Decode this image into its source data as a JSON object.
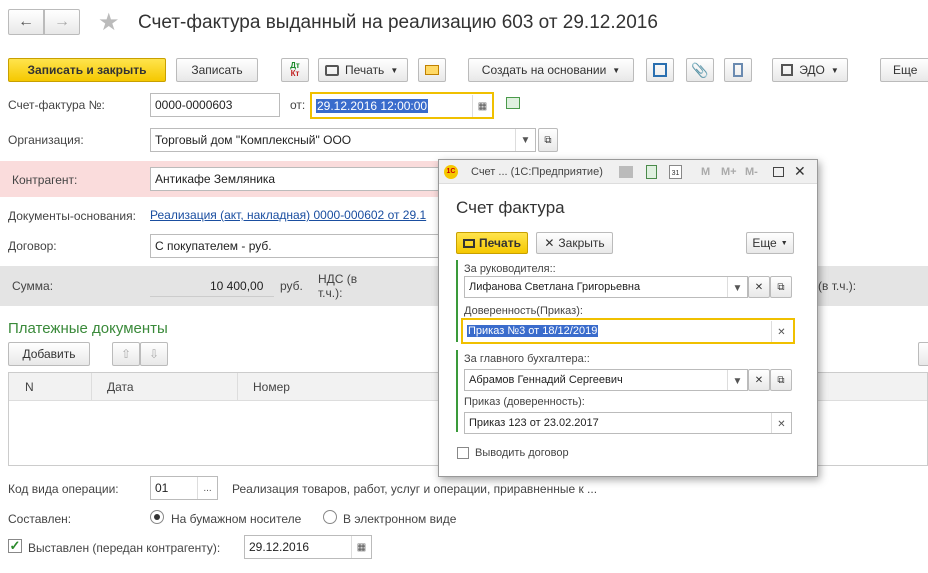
{
  "window": {
    "title": "Счет-фактура выданный на реализацию 603 от 29.12.2016"
  },
  "toolbar": {
    "save_close": "Записать и закрыть",
    "save": "Записать",
    "dtkt_top": "Дт",
    "dtkt_bottom": "Кт",
    "print": "Печать",
    "create_based": "Создать на основании",
    "edo": "ЭДО",
    "more": "Еще"
  },
  "form": {
    "invoice_label": "Счет-фактура №:",
    "invoice_number": "0000-0000603",
    "date_label": "от:",
    "date_value": "29.12.2016 12:00:00",
    "org_label": "Организация:",
    "org_value": "Торговый дом \"Комплексный\" ООО",
    "contractor_label": "Контрагент:",
    "contractor_value": "Антикафе Земляника",
    "docs_label": "Документы-основания:",
    "docs_value": "Реализация (акт, накладная) 0000-000602 от 29.1",
    "contract_label": "Договор:",
    "contract_value": "С покупателем - руб.",
    "sum_label": "Сумма:",
    "sum_value": "10 400,00",
    "sum_currency": "руб.",
    "vat_label": "НДС (в т.ч.):",
    "vat_label_right": "(в т.ч.):"
  },
  "payments": {
    "title": "Платежные документы",
    "add": "Добавить",
    "columns": [
      "N",
      "Дата",
      "Номер"
    ]
  },
  "bottom": {
    "op_code_label": "Код вида операции:",
    "op_code": "01",
    "op_code_desc": "Реализация товаров, работ, услуг и операции, приравненные к ...",
    "composed_label": "Составлен:",
    "paper": "На бумажном носителе",
    "electronic": "В электронном виде",
    "issued_label": "Выставлен (передан контрагенту):",
    "issued_date": "29.12.2016"
  },
  "dialog": {
    "title_bar": "Счет ...  (1С:Предприятие)",
    "title_icon": "1С",
    "heading": "Счет фактура",
    "print": "Печать",
    "close": "Закрыть",
    "more": "Еще",
    "manager_label": "За руководителя::",
    "manager_value": "Лифанова Светлана Григорьевна",
    "proxy_label": "Доверенность(Приказ):",
    "proxy_value": "Приказ №3 от 18/12/2019",
    "accountant_label": "За главного бухгалтера::",
    "accountant_value": "Абрамов Геннадий Сергеевич",
    "order_label": "Приказ (доверенность):",
    "order_value": "Приказ 123 от 23.02.2017",
    "show_contract": "Выводить договор",
    "m": "M",
    "mplus": "M+",
    "mminus": "M-"
  }
}
